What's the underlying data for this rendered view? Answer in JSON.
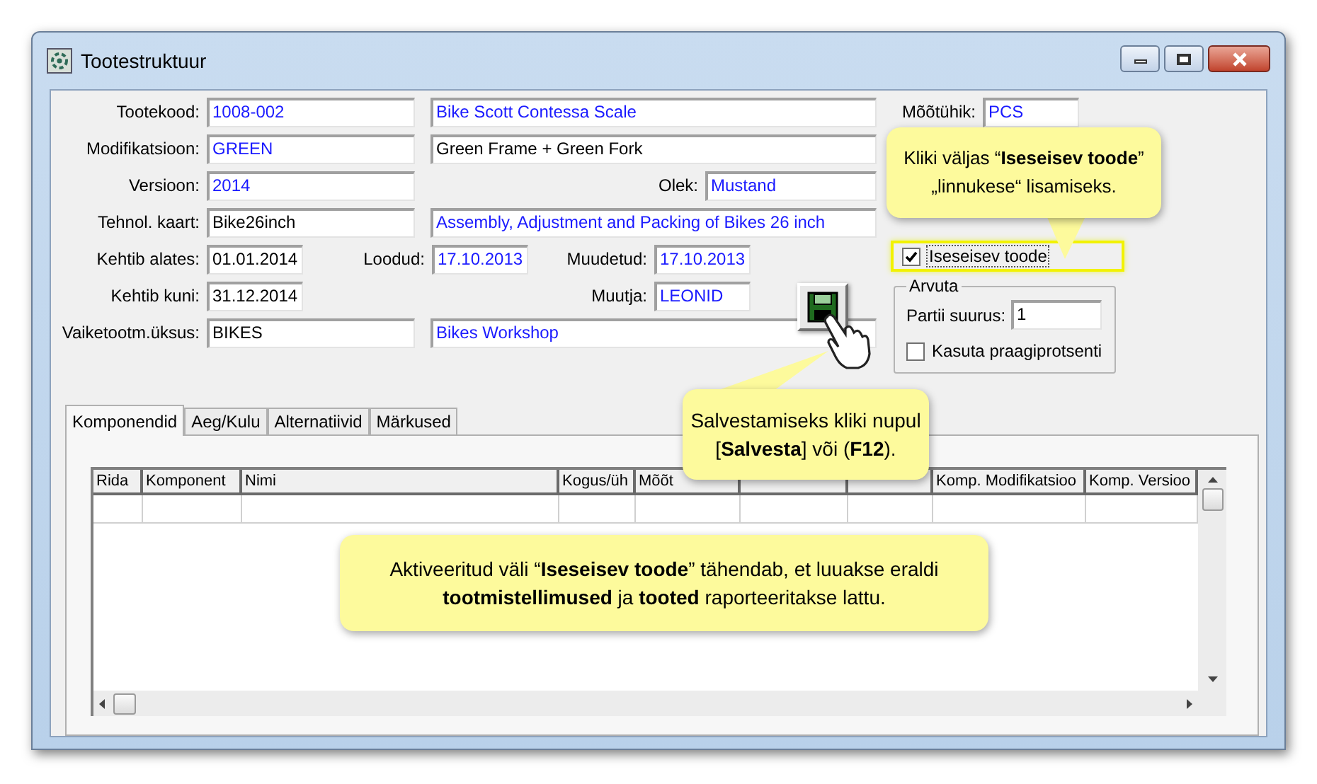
{
  "window": {
    "title": "Tootestruktuur"
  },
  "form_rows": [
    {
      "cells": [
        {
          "kind": "label",
          "text": "Tootekood:"
        },
        {
          "kind": "field",
          "text": "1008-002",
          "lookup": true
        },
        {
          "kind": "field",
          "text": "Bike Scott Contessa Scale",
          "lookup": true
        }
      ]
    },
    {
      "cells": [
        {
          "kind": "label",
          "text": "Modifikatsioon:"
        },
        {
          "kind": "field",
          "text": "GREEN",
          "lookup": true
        },
        {
          "kind": "field",
          "text": "Green Frame + Green Fork",
          "lookup": false
        }
      ]
    },
    {
      "cells": [
        {
          "kind": "label",
          "text": "Versioon:"
        },
        {
          "kind": "field",
          "text": "2014",
          "lookup": true
        },
        {
          "kind": "label",
          "text": "Olek:"
        },
        {
          "kind": "field",
          "text": "Mustand",
          "lookup": true
        }
      ]
    },
    {
      "cells": [
        {
          "kind": "label",
          "text": "Tehnol. kaart:"
        },
        {
          "kind": "field",
          "text": "Bike26inch",
          "lookup": false
        },
        {
          "kind": "field",
          "text": "Assembly, Adjustment and Packing of Bikes 26 inch",
          "lookup": true
        }
      ]
    },
    {
      "cells": [
        {
          "kind": "label",
          "text": "Kehtib alates:"
        },
        {
          "kind": "field",
          "text": "01.01.2014",
          "lookup": false
        },
        {
          "kind": "label",
          "text": "Loodud:"
        },
        {
          "kind": "field",
          "text": "17.10.2013",
          "lookup": true
        },
        {
          "kind": "label",
          "text": "Muudetud:"
        },
        {
          "kind": "field",
          "text": "17.10.2013",
          "lookup": true
        }
      ]
    },
    {
      "cells": [
        {
          "kind": "label",
          "text": "Kehtib kuni:"
        },
        {
          "kind": "field",
          "text": "31.12.2014",
          "lookup": false
        },
        {
          "kind": "label",
          "text": "Muutja:"
        },
        {
          "kind": "field",
          "text": "LEONID",
          "lookup": true
        }
      ]
    },
    {
      "cells": [
        {
          "kind": "label",
          "text": "Vaiketootm.üksus:"
        },
        {
          "kind": "field",
          "text": "BIKES",
          "lookup": false
        },
        {
          "kind": "field",
          "text": "Bikes Workshop",
          "lookup": true
        }
      ]
    }
  ],
  "unit": {
    "label": "Mõõtühik:",
    "value": "PCS",
    "lookup": true
  },
  "standalone": {
    "label": "Iseseisev toode",
    "checked": true,
    "highlighted": true
  },
  "calculate": {
    "title": "Arvuta",
    "batch_label": "Partii suurus:",
    "batch_value": "1",
    "scrap": {
      "label": "Kasuta praagiprotsenti",
      "checked": false
    }
  },
  "tabs": [
    {
      "label": "Komponendid",
      "selected": true
    },
    {
      "label": "Aeg/Kulu",
      "selected": false
    },
    {
      "label": "Alternatiivid",
      "selected": false
    },
    {
      "label": "Märkused",
      "selected": false
    }
  ],
  "table": {
    "columns": [
      "Rida",
      "Komponent",
      "Nimi",
      "Kogus/üh",
      "Mõõt",
      "Komp. Modifikatsioo",
      "Komp. Versioo"
    ]
  },
  "callouts": [
    {
      "text": "Kliki väljas “**Iseseisev toode**” „linnukese“ lisamiseks."
    },
    {
      "text": "Salvestamiseks kliki nupul [**Salvesta**] või (**F12**)."
    },
    {
      "text": "Aktiveeritud väli “**Iseseisev toode**” tähendab, et luuakse eraldi **tootmistellimused** ja **tooted** raporteeritakse lattu."
    }
  ]
}
